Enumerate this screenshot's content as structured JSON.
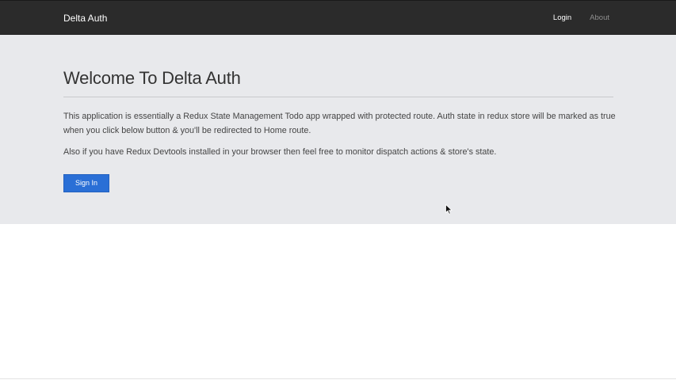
{
  "navbar": {
    "brand": "Delta Auth",
    "links": [
      {
        "label": "Login",
        "active": true
      },
      {
        "label": "About",
        "active": false
      }
    ]
  },
  "jumbotron": {
    "title": "Welcome To Delta Auth",
    "paragraph_1": "This application is essentially a Redux State Management Todo app wrapped with protected route. Auth state in redux store will be marked as true when you click below button & you'll be redirected to Home route.",
    "paragraph_2": "Also if you have Redux Devtools installed in your browser then feel free to monitor dispatch actions & store's state.",
    "button_label": "Sign In"
  },
  "colors": {
    "navbar_bg": "#2b2b2b",
    "jumbotron_bg": "#e8e9ec",
    "primary_button": "#2a6fd6"
  },
  "icons": {
    "cursor": "mouse-pointer-icon"
  }
}
